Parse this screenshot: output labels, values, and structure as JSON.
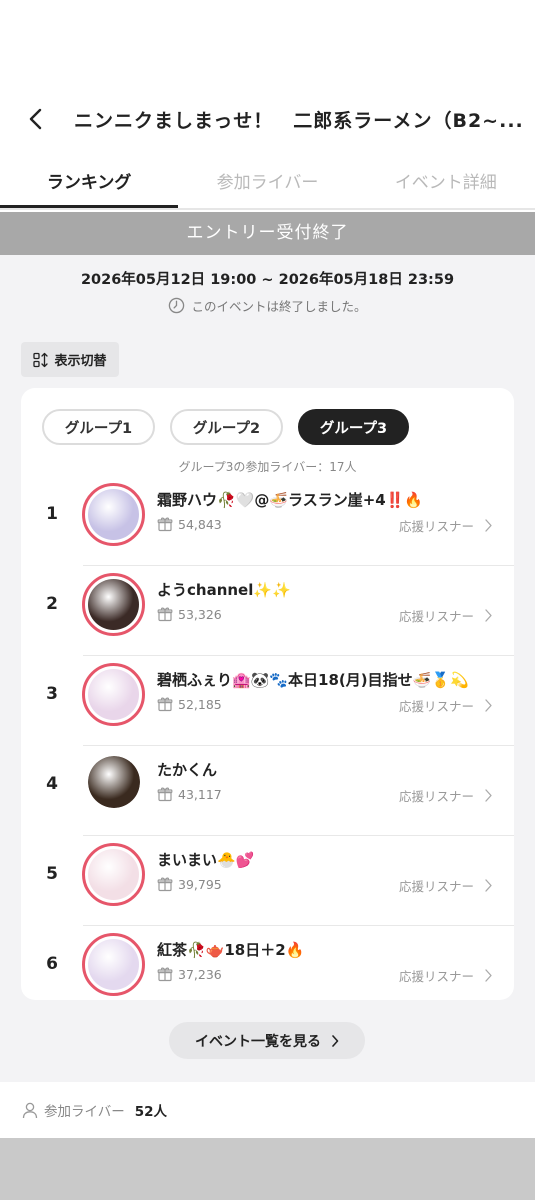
{
  "header": {
    "title": "ニンニクましまっせ！　二郎系ラーメン（B2~..."
  },
  "tabs": [
    {
      "label": "ランキング"
    },
    {
      "label": "参加ライバー"
    },
    {
      "label": "イベント詳細"
    }
  ],
  "status_bar": "エントリー受付終了",
  "period": "2026年05月12日 19:00 ~ 2026年05月18日 23:59",
  "ended_text": "このイベントは終了しました。",
  "switch_label": "表示切替",
  "groups": [
    {
      "label": "グループ1"
    },
    {
      "label": "グループ2"
    },
    {
      "label": "グループ3"
    }
  ],
  "group_count": "グループ3の参加ライバー：17人",
  "support_label": "応援リスナー",
  "rankings": [
    {
      "rank": "1",
      "name": "霜野ハウ🥀🤍@🍜ラスラン崖+4‼️🔥",
      "points": "54,843",
      "avatar_color": "#c7c2e6"
    },
    {
      "rank": "2",
      "name": "ようchannel✨✨",
      "points": "53,326",
      "avatar_color": "#3b2a26"
    },
    {
      "rank": "3",
      "name": "碧栖ふぇり🏩🐼🐾本日18(月)目指せ🍜🥇💫",
      "points": "52,185",
      "avatar_color": "#e9d6ea"
    },
    {
      "rank": "4",
      "name": "たかくん",
      "points": "43,117",
      "avatar_color": "#3a2a1f"
    },
    {
      "rank": "5",
      "name": "まいまい🐣💕",
      "points": "39,795",
      "avatar_color": "#f3dfe6"
    },
    {
      "rank": "6",
      "name": "紅茶🥀🫖18日＋2🔥",
      "points": "37,236",
      "avatar_color": "#e4d9ef"
    }
  ],
  "event_list_button": "イベント一覧を見る",
  "footer": {
    "label": "参加ライバー",
    "count": "52人"
  }
}
